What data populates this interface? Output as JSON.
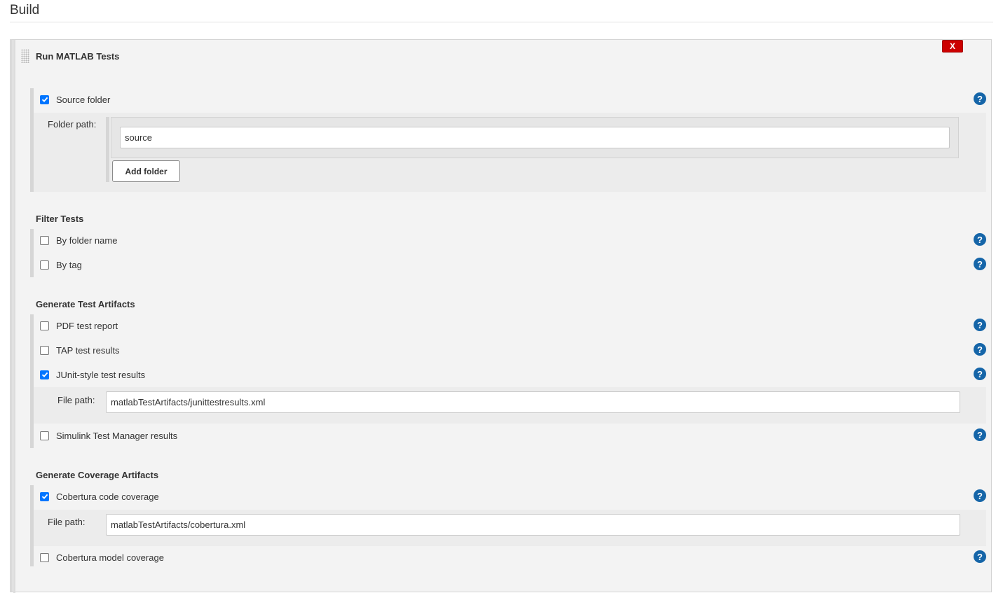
{
  "page": {
    "title": "Build"
  },
  "step": {
    "title": "Run MATLAB Tests",
    "delete_label": "X"
  },
  "source": {
    "checkbox_label": "Source folder",
    "checked": true,
    "folder_path_label": "Folder path:",
    "folder_value": "source",
    "add_folder_label": "Add folder"
  },
  "filter": {
    "header": "Filter Tests",
    "by_folder_label": "By folder name",
    "by_folder_checked": false,
    "by_tag_label": "By tag",
    "by_tag_checked": false
  },
  "test_artifacts": {
    "header": "Generate Test Artifacts",
    "pdf_label": "PDF test report",
    "pdf_checked": false,
    "tap_label": "TAP test results",
    "tap_checked": false,
    "junit_label": "JUnit-style test results",
    "junit_checked": true,
    "junit_file_label": "File path:",
    "junit_file_value": "matlabTestArtifacts/junittestresults.xml",
    "simulink_label": "Simulink Test Manager results",
    "simulink_checked": false
  },
  "coverage": {
    "header": "Generate Coverage Artifacts",
    "cobertura_code_label": "Cobertura code coverage",
    "cobertura_code_checked": true,
    "cobertura_file_label": "File path:",
    "cobertura_file_value": "matlabTestArtifacts/cobertura.xml",
    "cobertura_model_label": "Cobertura model coverage",
    "cobertura_model_checked": false
  },
  "help": {
    "glyph": "?"
  },
  "colors": {
    "delete_button": "#cc0000",
    "help_icon": "#1565a8",
    "checkbox_checked": "#0075ff"
  },
  "icons": {
    "drag": "drag-handle-icon",
    "help": "help-icon",
    "check": "checkmark-icon"
  }
}
